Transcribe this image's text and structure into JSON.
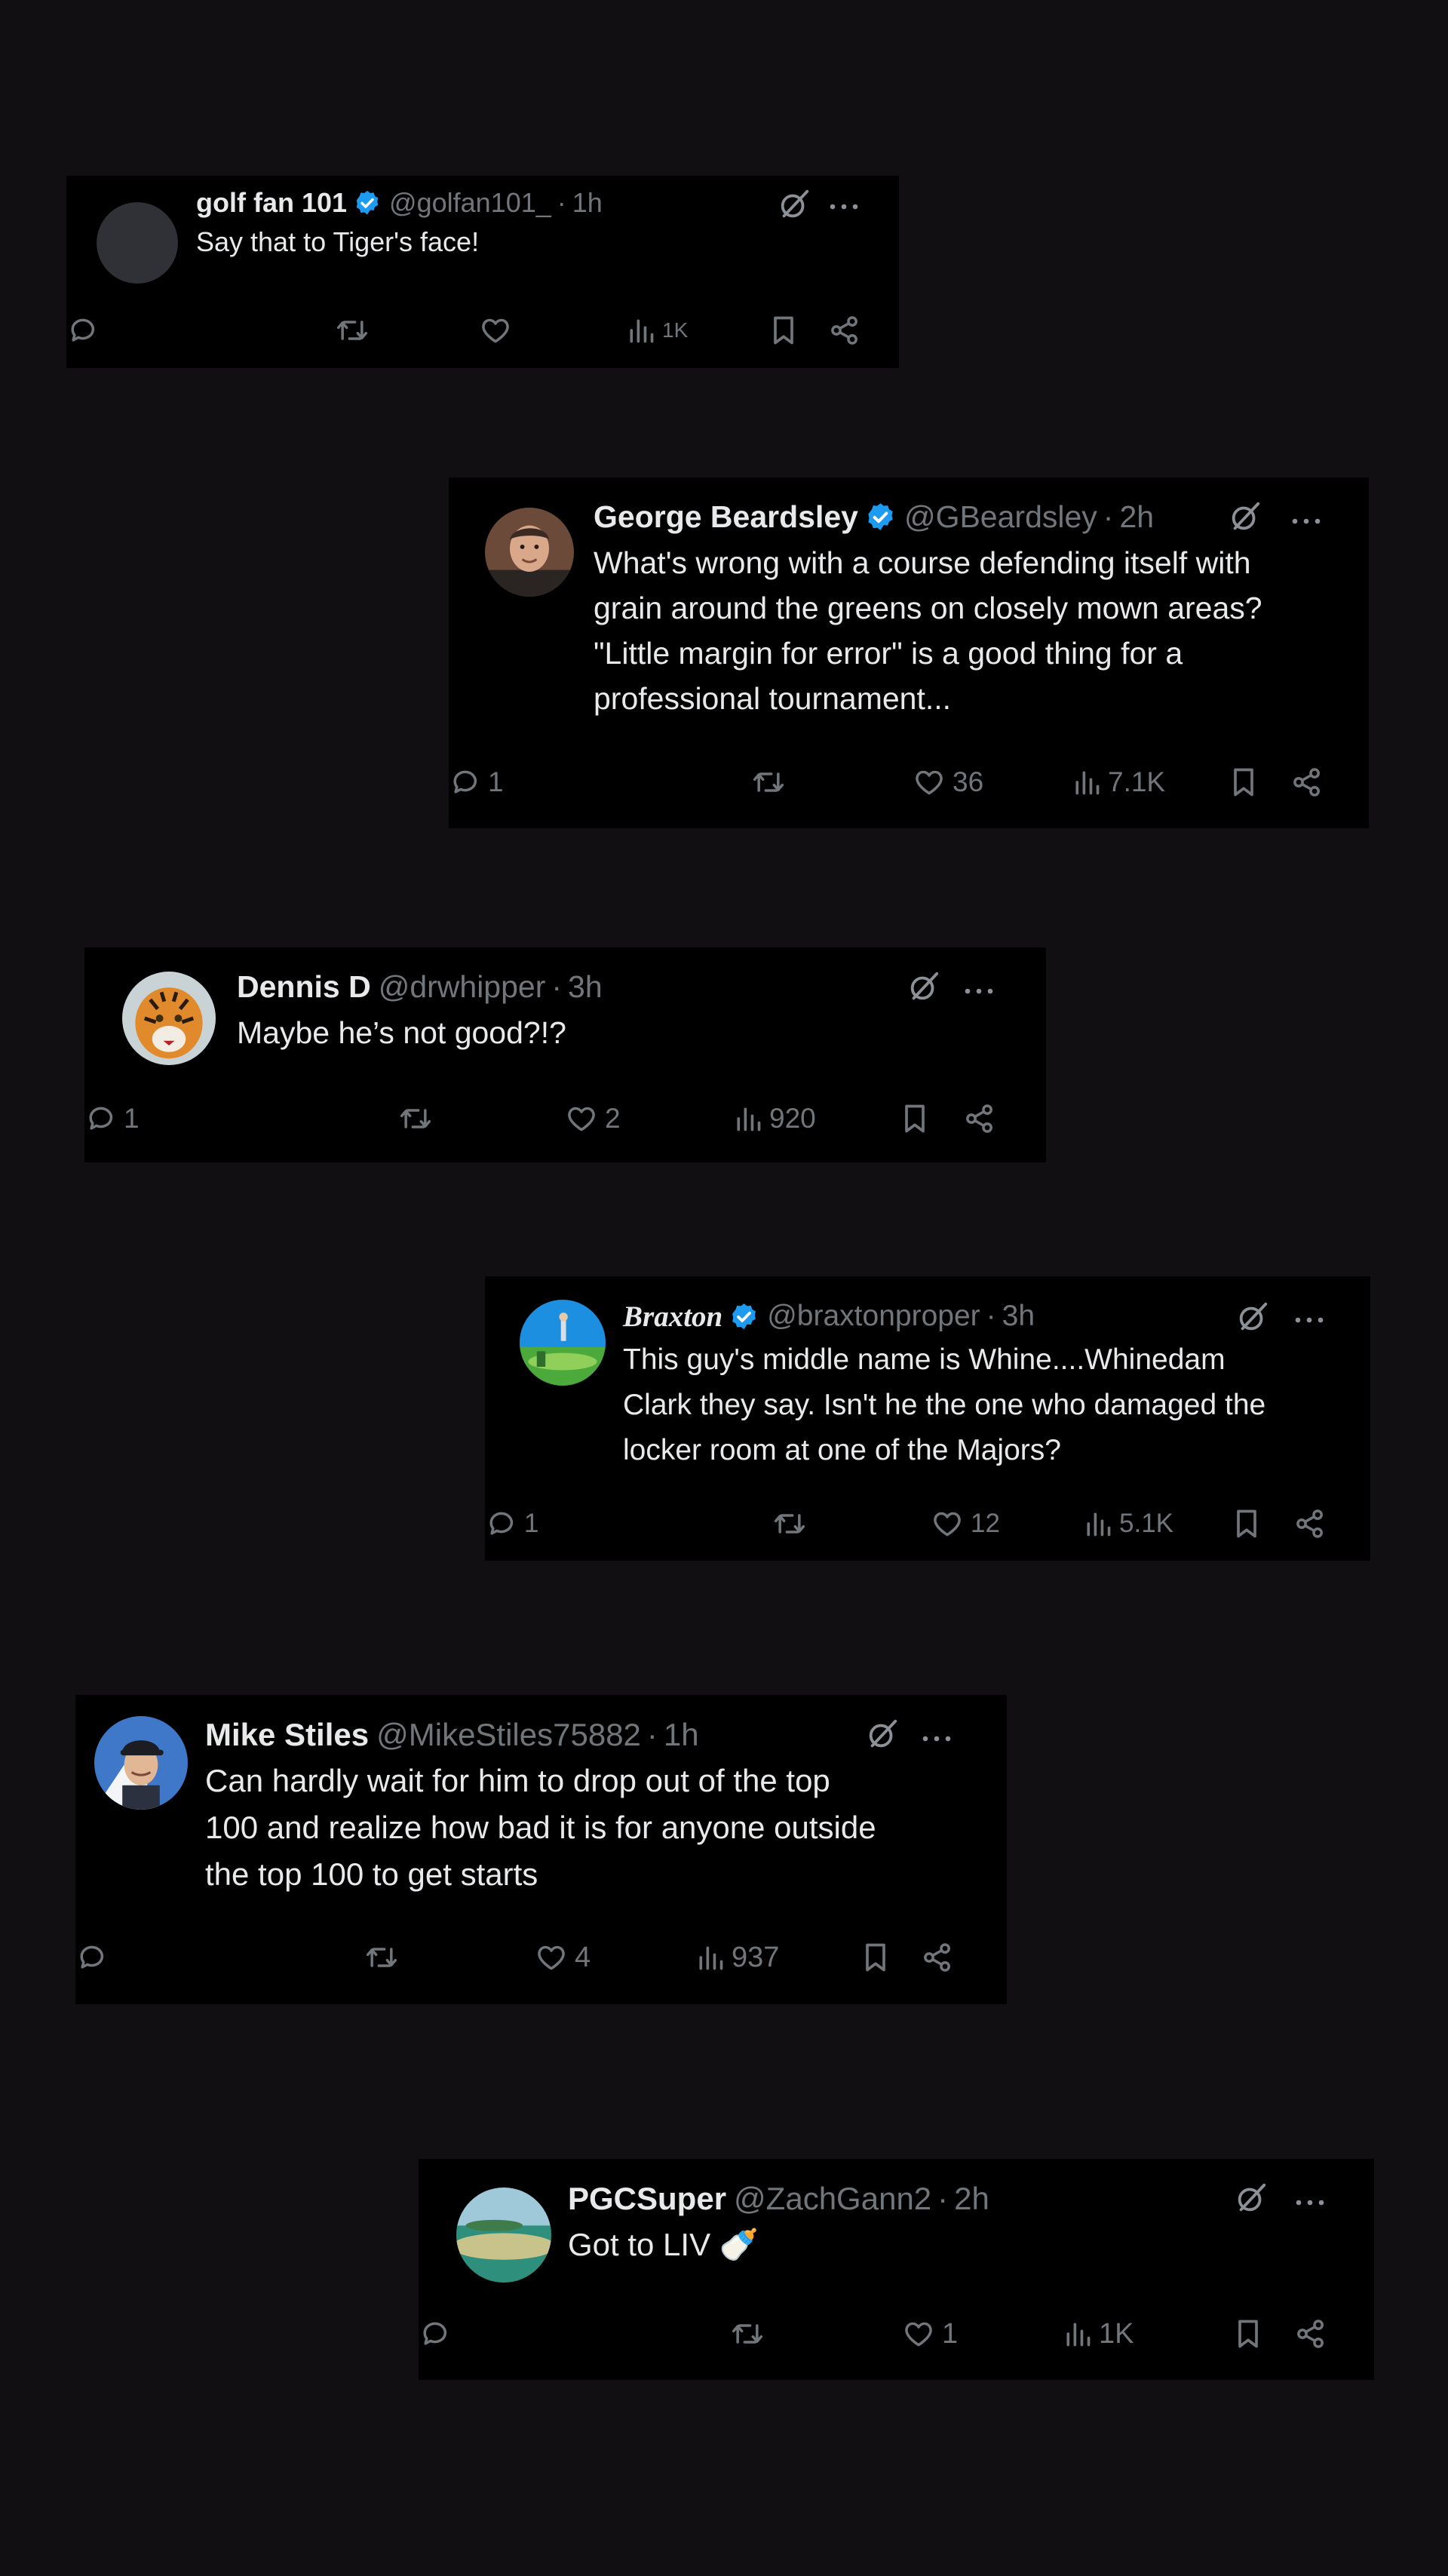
{
  "tweets": [
    {
      "name": "golf fan 101",
      "verified": true,
      "handle": "@golfan101_",
      "separator": "·",
      "time": "1h",
      "lines": [
        "Say that to Tiger's face!"
      ],
      "replies": "",
      "retweets": "",
      "likes": "",
      "views": "1K",
      "avatar": "gray-circle"
    },
    {
      "name": "George Beardsley",
      "verified": true,
      "handle": "@GBeardsley",
      "separator": "·",
      "time": "2h",
      "lines": [
        "What's wrong with a course defending itself with",
        "grain around the greens on closely mown areas?",
        "\"Little margin for error\" is a good thing for a",
        "professional tournament..."
      ],
      "replies": "1",
      "retweets": "",
      "likes": "36",
      "views": "7.1K",
      "avatar": "man-photo"
    },
    {
      "name": "Dennis D",
      "verified": false,
      "handle": "@drwhipper",
      "separator": "·",
      "time": "3h",
      "lines": [
        "Maybe he’s not good?!?"
      ],
      "replies": "1",
      "retweets": "",
      "likes": "2",
      "views": "920",
      "avatar": "tiger"
    },
    {
      "name": "Braxton",
      "verified": true,
      "handle": "@braxtonproper",
      "separator": "·",
      "time": "3h",
      "lines": [
        "This guy's middle name is Whine....Whinedam",
        "Clark they say.  Isn't he the one who damaged the",
        "locker room at one of the Majors?"
      ],
      "replies": "1",
      "retweets": "",
      "likes": "12",
      "views": "5.1K",
      "avatar": "golf-course"
    },
    {
      "name": "Mike Stiles",
      "verified": false,
      "handle": "@MikeStiles75882",
      "separator": "·",
      "time": "1h",
      "lines": [
        "Can hardly wait for him to drop out of the top",
        "100 and realize how bad it is for anyone outside",
        "the top 100 to get starts"
      ],
      "replies": "",
      "retweets": "",
      "likes": "4",
      "views": "937",
      "avatar": "man-cap"
    },
    {
      "name": "PGCSuper",
      "verified": false,
      "handle": "@ZachGann2",
      "separator": "·",
      "time": "2h",
      "lines": [
        "Got to LIV 🍼"
      ],
      "replies": "",
      "retweets": "",
      "likes": "1",
      "views": "1K",
      "avatar": "landscape"
    }
  ],
  "icons": {
    "reply": "reply-icon",
    "retweet": "retweet-icon",
    "like": "heart-icon",
    "views": "views-icon",
    "bookmark": "bookmark-icon",
    "share": "share-icon",
    "grok": "grok-icon",
    "more": "more-icon",
    "verified": "verified-badge-icon"
  },
  "colors": {
    "background": "#120f13",
    "card": "#000000",
    "text": "#e7e9ea",
    "secondary": "#71767b",
    "verified": "#1d9bf0"
  }
}
